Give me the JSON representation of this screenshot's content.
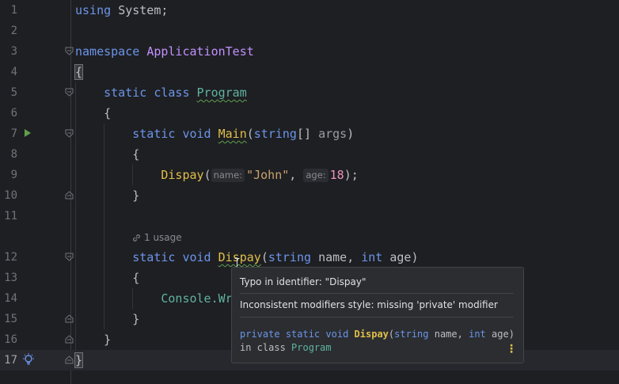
{
  "editor": {
    "lines": [
      {
        "n": "1"
      },
      {
        "n": "2"
      },
      {
        "n": "3"
      },
      {
        "n": "4"
      },
      {
        "n": "5"
      },
      {
        "n": "6"
      },
      {
        "n": "7"
      },
      {
        "n": "8"
      },
      {
        "n": "9"
      },
      {
        "n": "10"
      },
      {
        "n": "11"
      },
      {
        "n": "12"
      },
      {
        "n": "13"
      },
      {
        "n": "14"
      },
      {
        "n": "15"
      },
      {
        "n": "16"
      },
      {
        "n": "17"
      }
    ],
    "tokens": {
      "using": "using",
      "system": "System;",
      "namespace": "namespace",
      "ns_name": "ApplicationTest",
      "open_brace": "{",
      "close_brace": "}",
      "static": "static",
      "class": "class",
      "program": "Program",
      "void": "void",
      "main": "Main",
      "string_kw": "string",
      "brackets": "[]",
      "args": "args",
      "paren_open": "(",
      "paren_close": ")",
      "dispay": "Dispay",
      "hint_name": "name:",
      "john": "\"John\"",
      "comma": ",",
      "hint_age": "age:",
      "eighteen": "18",
      "semi": ");",
      "name_param": "name",
      "int_kw": "int",
      "age_param": "age",
      "console_partial": "Console.Wr"
    },
    "usage_hint": "1 usage",
    "current_line": 17
  },
  "popup": {
    "typo_message": "Typo in identifier: \"Dispay\"",
    "modifier_message": "Inconsistent modifiers style: missing 'private' modifier",
    "sig": {
      "private": "private",
      "static": "static",
      "void": "void",
      "name": "Dispay",
      "string_kw": "string",
      "p1": "name",
      "int_kw": "int",
      "p2": "age",
      "in_class": "in class",
      "class_name": "Program"
    },
    "more_icon": "more-vertical-icon"
  },
  "colors": {
    "background": "#1e1f22",
    "keyword": "#6c95eb",
    "type": "#c191ff",
    "method": "#e1bf4b",
    "string": "#c9a26d",
    "number": "#ed94c0"
  }
}
